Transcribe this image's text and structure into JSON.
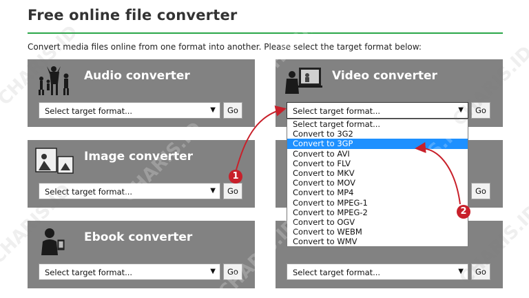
{
  "page": {
    "title": "Free online file converter",
    "intro": "Convert media files online from one format into another. Please select the target format below:"
  },
  "cards": {
    "audio": {
      "title": "Audio converter",
      "select": "Select target format...",
      "go": "Go"
    },
    "video": {
      "title": "Video converter",
      "select": "Select target format...",
      "go": "Go"
    },
    "image": {
      "title": "Image converter",
      "select": "Select target format...",
      "go": "Go"
    },
    "right_middle": {
      "go": "Go"
    },
    "ebook": {
      "title": "Ebook converter",
      "select": "Select target format...",
      "go": "Go"
    },
    "right_bottom": {
      "select": "Select target format...",
      "go": "Go"
    }
  },
  "dropdown": {
    "options": [
      "Select target format...",
      "Convert to 3G2",
      "Convert to 3GP",
      "Convert to AVI",
      "Convert to FLV",
      "Convert to MKV",
      "Convert to MOV",
      "Convert to MP4",
      "Convert to MPEG-1",
      "Convert to MPEG-2",
      "Convert to OGV",
      "Convert to WEBM",
      "Convert to WMV"
    ],
    "selected_index": 2,
    "highlight_color": "#1e90ff"
  },
  "annotations": {
    "marker_1": "1",
    "marker_2": "2",
    "arrow_color": "#c8202a"
  },
  "watermark": "CHARIS.ID",
  "colors": {
    "accent_rule": "#2aa748",
    "card_bg": "#828282"
  }
}
